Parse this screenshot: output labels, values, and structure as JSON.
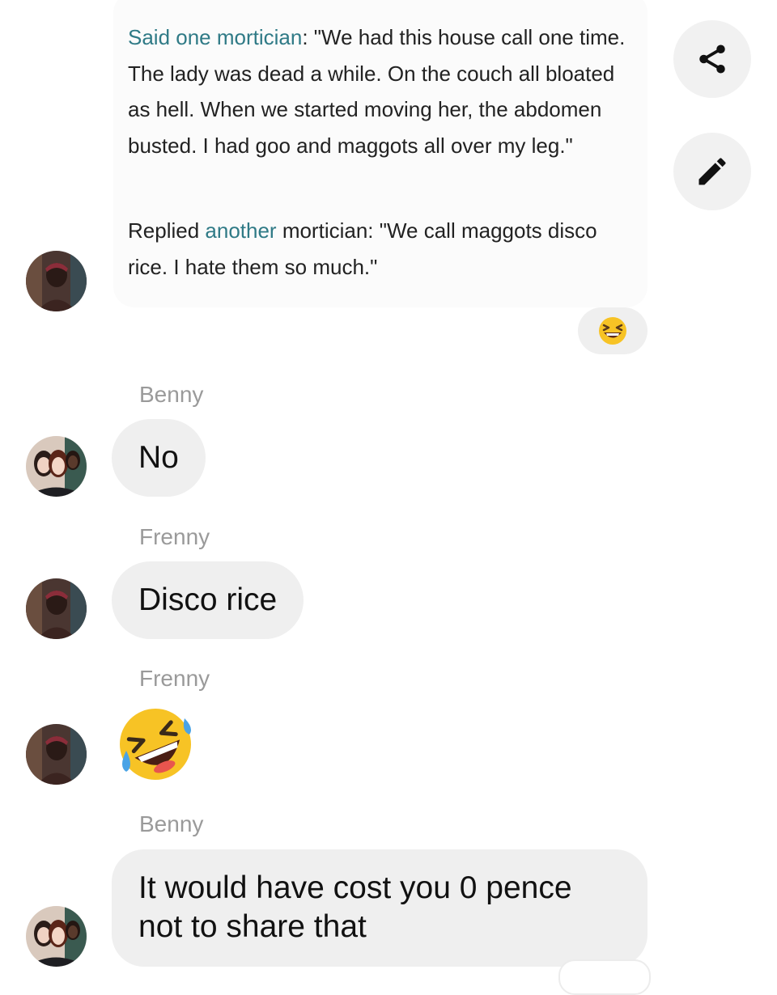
{
  "shared_post": {
    "paragraph1": {
      "link": "Said one mortician",
      "text": ": \"We had this house call one time. The lady was dead a while. On the couch all bloated as hell. When we started moving her, the abdomen busted. I had goo and maggots all over my leg.\""
    },
    "paragraph2": {
      "prefix": "Replied ",
      "link": "another",
      "text": " mortician: \"We call maggots disco rice. I hate them so much.\""
    }
  },
  "actions": {
    "share_icon": "share-icon",
    "edit_icon": "pencil-icon"
  },
  "reaction": {
    "emoji": "laughing-face-icon"
  },
  "messages": [
    {
      "sender": "Benny",
      "text": "No"
    },
    {
      "sender": "Frenny",
      "text": "Disco rice"
    },
    {
      "sender": "Frenny",
      "emoji": "rolling-on-floor-laughing-icon"
    },
    {
      "sender": "Benny",
      "lines": [
        "It would have cost you 0 pence",
        "not to share that"
      ]
    }
  ],
  "colors": {
    "link": "#2f7a86",
    "bubble": "#efefef",
    "sender": "#9a9a9a",
    "emoji_yellow": "#f7c325"
  }
}
